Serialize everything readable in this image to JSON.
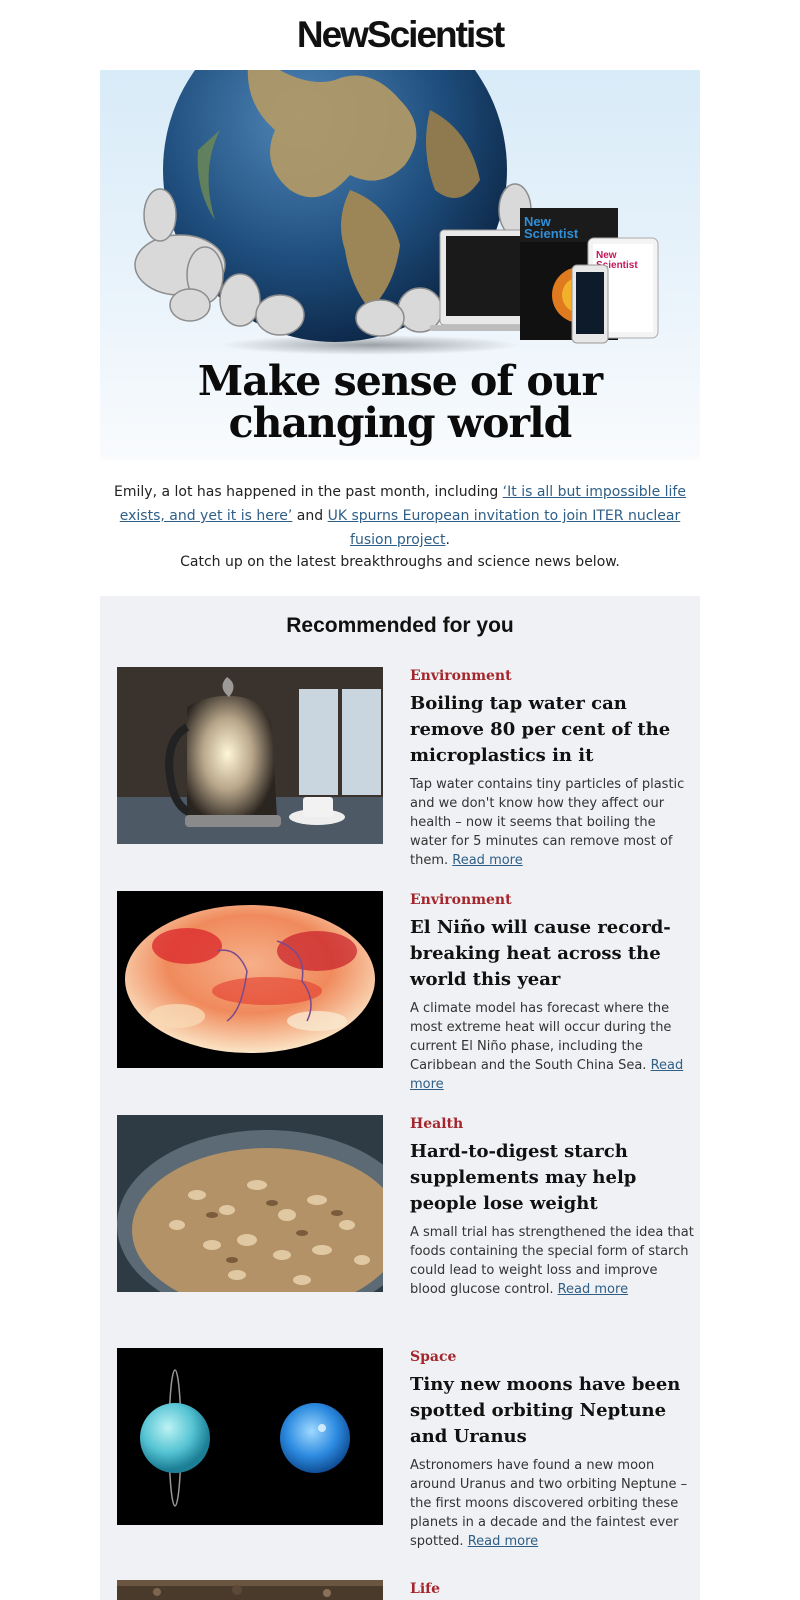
{
  "brand": {
    "logo_text": "NewScientist"
  },
  "hero": {
    "title_line1": "Make sense of our",
    "title_line2": "changing world"
  },
  "intro": {
    "prefix": "Emily, a lot has happened in the past month, including ",
    "link1": "‘It is all but impossible life exists, and yet it is here’",
    "middle": " and ",
    "link2": "UK spurns European invitation to join ITER nuclear fusion project",
    "suffix": ".",
    "catch_up": "Catch up on the latest breakthroughs and science news below."
  },
  "recommended": {
    "heading": "Recommended for you",
    "read_more": "Read more",
    "articles": [
      {
        "category": "Environment",
        "headline": "Boiling tap water can remove 80 per cent of the microplastics in it",
        "summary": "Tap water contains tiny particles of plastic and we don't know how they affect our health – now it seems that boiling the water for 5 minutes can remove most of them. ",
        "image": "kettle-photo"
      },
      {
        "category": "Environment",
        "headline": "El Niño will cause record-breaking heat across the world this year",
        "summary": "A climate model has forecast where the most extreme heat will occur during the current El Niño phase, including the Caribbean and the South China Sea. ",
        "image": "heat-map-globe"
      },
      {
        "category": "Health",
        "headline": "Hard-to-digest starch supplements may help people lose weight",
        "summary": "A small trial has strengthened the idea that foods containing the special form of starch could lead to weight loss and improve blood glucose control. ",
        "image": "starch-jar-photo"
      },
      {
        "category": "Space",
        "headline": "Tiny new moons have been spotted orbiting Neptune and Uranus",
        "summary": "Astronomers have found a new moon around Uranus and two orbiting Neptune – the first moons discovered orbiting these planets in a decade and the faintest ever spotted. ",
        "image": "uranus-neptune-photo"
      },
      {
        "category": "Life",
        "headline": "",
        "summary": "",
        "image": "partial-photo"
      }
    ]
  },
  "colors": {
    "category_red": "#a4262c",
    "link_blue": "#2f5f86",
    "panel_grey": "#eff1f4"
  }
}
